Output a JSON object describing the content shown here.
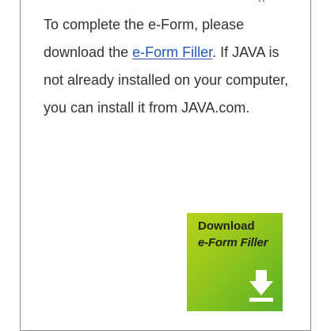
{
  "panel": {
    "text_before_link": "To complete the e-Form, please download the ",
    "link_text": "e-Form Filler",
    "text_after_link": ". If JAVA is not already installed on your computer, you can install it from JAVA.com."
  },
  "download_button": {
    "line1": "Download",
    "line2": "e-Form Filler",
    "icon": "download-arrow-icon"
  },
  "colors": {
    "link": "#2457b6",
    "button_green": "#92c51c",
    "border": "#8a8a8a"
  }
}
